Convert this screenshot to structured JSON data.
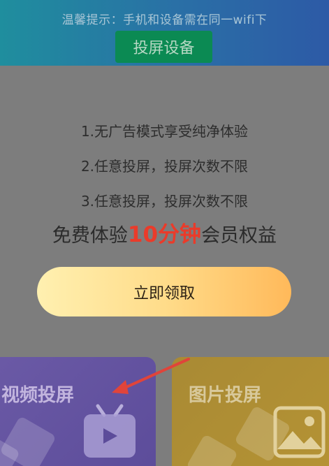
{
  "header": {
    "tip": "温馨提示：手机和设备需在同一wifi下",
    "cast_device_button": "投屏设备"
  },
  "benefits": [
    "1.无广告模式享受纯净体验",
    "2.任意投屏，投屏次数不限",
    "3.任意投屏，投屏次数不限"
  ],
  "promo": {
    "prefix": "免费体验",
    "highlight": "10分钟",
    "suffix": "会员权益"
  },
  "claim_button": "立即领取",
  "cards": {
    "video": {
      "title": "视频投屏",
      "icon": "tv-play-icon"
    },
    "image": {
      "title": "图片投屏",
      "icon": "image-icon"
    }
  },
  "colors": {
    "header_start": "#1f8e9e",
    "cast_button": "#0b8a53",
    "highlight": "#ea3b2a",
    "claim_start": "#fff0b0",
    "claim_end": "#ffb95a",
    "arrow": "#e0443a"
  }
}
